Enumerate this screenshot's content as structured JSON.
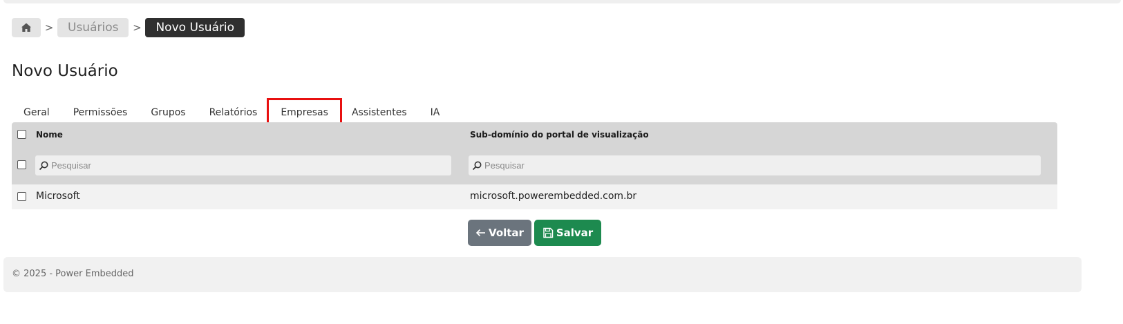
{
  "breadcrumb": {
    "home_icon": "home-icon",
    "separator": ">",
    "items": [
      {
        "label": "Usuários"
      },
      {
        "label": "Novo Usuário"
      }
    ]
  },
  "page": {
    "title": "Novo Usuário"
  },
  "tabs": [
    {
      "label": "Geral"
    },
    {
      "label": "Permissões"
    },
    {
      "label": "Grupos"
    },
    {
      "label": "Relatórios"
    },
    {
      "label": "Empresas",
      "active": true
    },
    {
      "label": "Assistentes"
    },
    {
      "label": "IA"
    }
  ],
  "grid": {
    "columns": [
      {
        "header": "Nome",
        "search_placeholder": "Pesquisar"
      },
      {
        "header": "Sub-domínio do portal de visualização",
        "search_placeholder": "Pesquisar"
      }
    ],
    "rows": [
      {
        "name": "Microsoft",
        "subdomain": "microsoft.powerembedded.com.br"
      }
    ]
  },
  "actions": {
    "back_label": "Voltar",
    "back_icon": "arrow-left-icon",
    "save_label": "Salvar",
    "save_icon": "floppy-disk-icon"
  },
  "footer": {
    "text": "© 2025 - Power Embedded"
  },
  "colors": {
    "active_crumb": "#2f2f2f",
    "save_button": "#1d8a4f",
    "back_button": "#6b747d",
    "tab_highlight": "#e81010",
    "grid_header": "#d6d6d6"
  }
}
